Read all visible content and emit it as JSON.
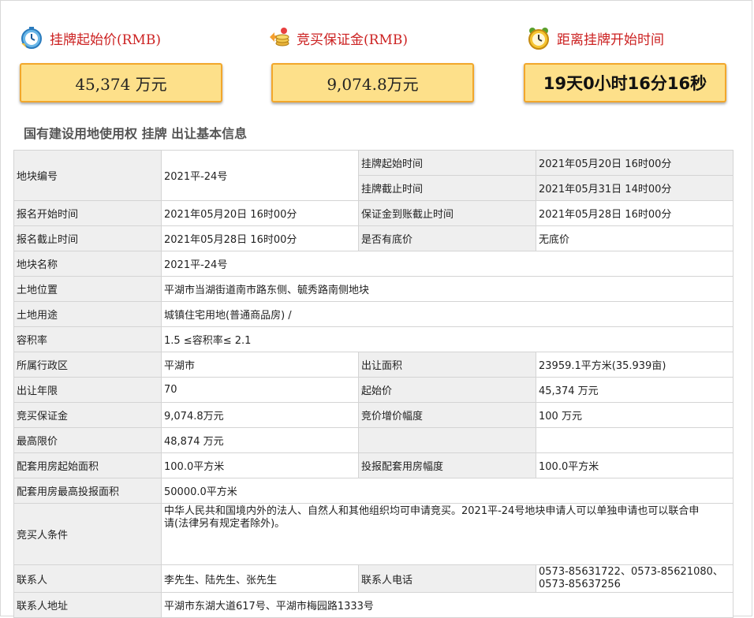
{
  "stats": [
    {
      "label": "挂牌起始价(RMB)",
      "value": "45,374 万元",
      "icon": "stopwatch-icon"
    },
    {
      "label": "竞买保证金(RMB)",
      "value": "9,074.8万元",
      "icon": "coins-icon"
    },
    {
      "label": "距离挂牌开始时间",
      "value": "19天0小时16分16秒",
      "icon": "alarm-clock-icon"
    }
  ],
  "section_title": "国有建设用地使用权 挂牌 出让基本信息",
  "info": {
    "plot_no_label": "地块编号",
    "plot_no": "2021平-24号",
    "listing_start_label": "挂牌起始时间",
    "listing_start": "2021年05月20日 16时00分",
    "listing_end_label": "挂牌截止时间",
    "listing_end": "2021年05月31日 14时00分",
    "reg_start_label": "报名开始时间",
    "reg_start": "2021年05月20日 16时00分",
    "deposit_deadline_label": "保证金到账截止时间",
    "deposit_deadline": "2021年05月28日 16时00分",
    "reg_end_label": "报名截止时间",
    "reg_end": "2021年05月28日 16时00分",
    "reserve_label": "是否有底价",
    "reserve": "无底价",
    "plot_name_label": "地块名称",
    "plot_name": "2021平-24号",
    "location_label": "土地位置",
    "location": "平湖市当湖街道南市路东侧、毓秀路南侧地块",
    "usage_label": "土地用途",
    "usage": "城镇住宅用地(普通商品房) /",
    "far_label": "容积率",
    "far": "1.5 ≤容积率≤ 2.1",
    "district_label": "所属行政区",
    "district": "平湖市",
    "area_label": "出让面积",
    "area": "23959.1平方米(35.939亩)",
    "term_label": "出让年限",
    "term": "70",
    "start_price_label": "起始价",
    "start_price": "45,374 万元",
    "deposit_label": "竞买保证金",
    "deposit": "9,074.8万元",
    "increment_label": "竞价增价幅度",
    "increment": "100 万元",
    "max_price_label": "最高限价",
    "max_price": "48,874 万元",
    "support_start_label": "配套用房起始面积",
    "support_start": "100.0平方米",
    "support_step_label": "投报配套用房幅度",
    "support_step": "100.0平方米",
    "support_max_label": "配套用房最高投报面积",
    "support_max": "50000.0平方米",
    "bidder_label": "竞买人条件",
    "bidder": "中华人民共和国境内外的法人、自然人和其他组织均可申请竞买。2021平-24号地块申请人可以单独申请也可以联合申请(法律另有规定者除外)。",
    "contact_label": "联系人",
    "contact": "李先生、陆先生、张先生",
    "phone_label": "联系人电话",
    "phone": "0573-85631722、0573-85621080、0573-85637256",
    "address_label": "联系人地址",
    "address": "平湖市东湖大道617号、平湖市梅园路1333号"
  }
}
